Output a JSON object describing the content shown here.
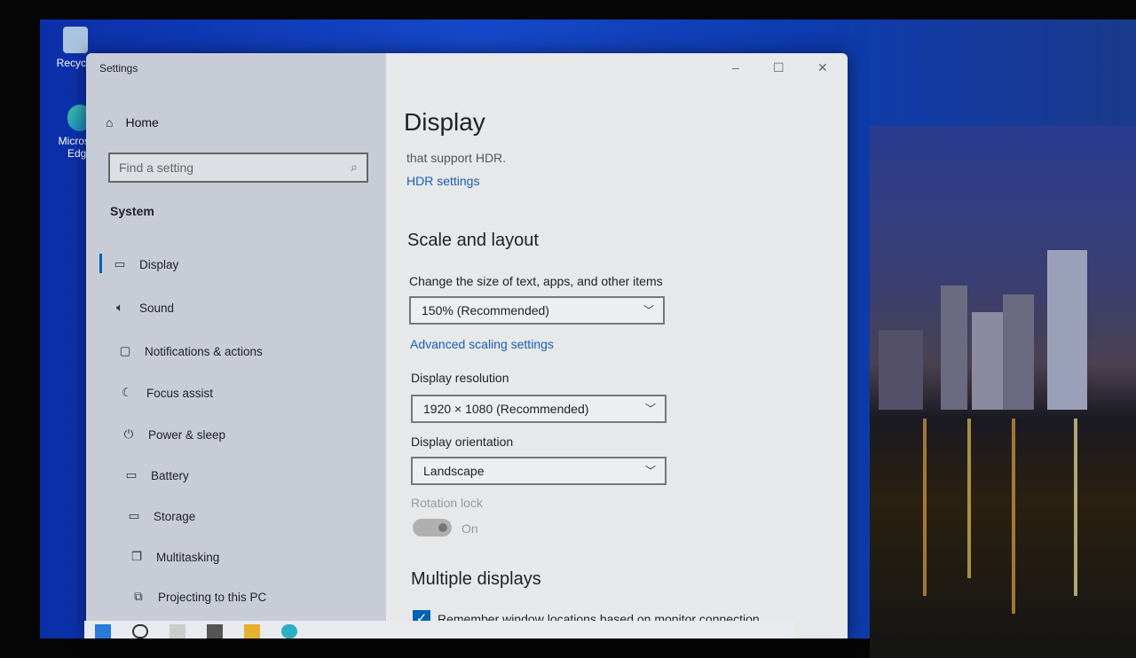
{
  "desktop": {
    "icons": [
      {
        "label": "Recycle",
        "icon": "recycle-bin-icon"
      },
      {
        "label": "Microsoft Edge",
        "icon": "edge-icon"
      }
    ]
  },
  "window": {
    "title": "Settings",
    "controls": {
      "minimize": "–",
      "maximize": "☐",
      "close": "✕"
    }
  },
  "sidebar": {
    "home": "Home",
    "search_placeholder": "Find a setting",
    "section": "System",
    "items": [
      {
        "label": "Display",
        "icon": "monitor-icon",
        "selected": true
      },
      {
        "label": "Sound",
        "icon": "speaker-icon"
      },
      {
        "label": "Notifications & actions",
        "icon": "notification-icon"
      },
      {
        "label": "Focus assist",
        "icon": "moon-icon"
      },
      {
        "label": "Power & sleep",
        "icon": "power-icon"
      },
      {
        "label": "Battery",
        "icon": "battery-icon"
      },
      {
        "label": "Storage",
        "icon": "storage-icon"
      },
      {
        "label": "Multitasking",
        "icon": "multitasking-icon"
      },
      {
        "label": "Projecting to this PC",
        "icon": "projecting-icon"
      }
    ]
  },
  "main": {
    "title": "Display",
    "hdr_text": "that support HDR.",
    "hdr_link": "HDR settings",
    "scale_heading": "Scale and layout",
    "scale_label": "Change the size of text, apps, and other items",
    "scale_value": "150% (Recommended)",
    "advanced_link": "Advanced scaling settings",
    "resolution_label": "Display resolution",
    "resolution_value": "1920 × 1080 (Recommended)",
    "orientation_label": "Display orientation",
    "orientation_value": "Landscape",
    "rotation_label": "Rotation lock",
    "rotation_state": "On",
    "rotation_enabled": false,
    "multiple_heading": "Multiple displays",
    "remember_label": "Remember window locations based on monitor connection",
    "remember_checked": true
  },
  "colors": {
    "accent": "#0063b1",
    "link": "#1a5fb4"
  }
}
